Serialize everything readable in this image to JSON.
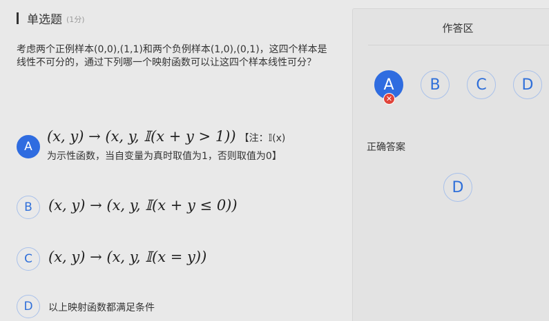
{
  "header": {
    "title": "单选题",
    "score": "(1分)"
  },
  "question": {
    "text": "考虑两个正例样本(0,0),(1,1)和两个负例样本(1,0),(0,1)，这四个样本是线性不可分的，通过下列哪一个映射函数可以让这四个样本线性可分？"
  },
  "options": [
    {
      "letter": "A",
      "math": "(x, y) → (x, y, 𝕀(x + y > 1))",
      "note": "【注：𝕀(x)",
      "line2": "为示性函数，当自变量为真时取值为1，否则取值为0】"
    },
    {
      "letter": "B",
      "math": "(x, y) → (x, y, 𝕀(x + y ≤ 0))"
    },
    {
      "letter": "C",
      "math": "(x, y) → (x, y, 𝕀(x = y))"
    },
    {
      "letter": "D",
      "text": "以上映射函数都满足条件"
    }
  ],
  "answer_panel": {
    "title": "作答区",
    "choices": [
      "A",
      "B",
      "C",
      "D"
    ],
    "selected": "A",
    "wrong_icon": "✕",
    "correct_label": "正确答案",
    "correct_answer": "D"
  },
  "colors": {
    "accent": "#2f6ce0",
    "wrong": "#e0443a",
    "circle_border": "#a9c1ea"
  }
}
